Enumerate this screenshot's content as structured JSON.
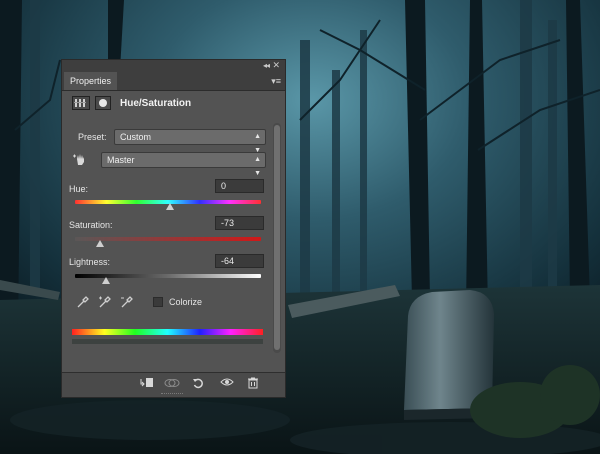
{
  "panel": {
    "tab_label": "Properties",
    "title": "Hue/Saturation",
    "preset_label": "Preset:",
    "preset_value": "Custom",
    "channel_value": "Master",
    "hue_label": "Hue:",
    "hue_value": "0",
    "saturation_label": "Saturation:",
    "saturation_value": "-73",
    "lightness_label": "Lightness:",
    "lightness_value": "-64",
    "colorize_label": "Colorize",
    "colorize_checked": false
  },
  "icons": {
    "collapse": "double-chevron-left-icon",
    "close": "close-icon",
    "menu": "panel-menu-icon",
    "adjustment": "hue-saturation-adjustment-icon",
    "mask": "layer-mask-icon",
    "target": "targeted-adjustment-hand-icon",
    "eyedroppers": [
      "eyedropper-icon",
      "eyedropper-plus-icon",
      "eyedropper-minus-icon"
    ],
    "bottom": [
      "clip-to-layer-icon",
      "view-previous-state-icon",
      "reset-icon",
      "visibility-eye-icon",
      "trash-icon"
    ]
  },
  "colors": {
    "panel_bg": "#535353",
    "panel_dark": "#3e3e3e",
    "field_bg": "#3b3b3b"
  }
}
